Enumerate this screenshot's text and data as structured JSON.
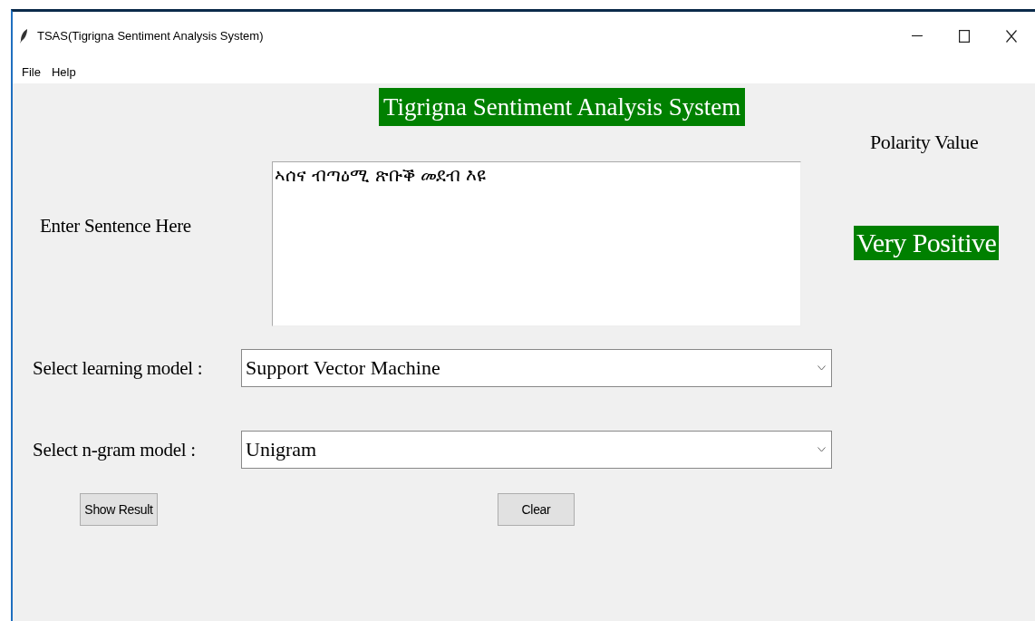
{
  "window": {
    "title": "TSAS(Tigrigna Sentiment Analysis System)"
  },
  "menu": [
    "File",
    "Help"
  ],
  "header": "Tigrigna Sentiment Analysis System",
  "sentence": {
    "label": "Enter Sentence Here",
    "value": "ኣሰና ብጣዕሚ ጽቡቕ መደብ እዩ"
  },
  "polarity": {
    "label": "Polarity Value",
    "value": "Very Positive"
  },
  "selects": [
    {
      "label": "Select learning model :",
      "value": "Support Vector Machine"
    },
    {
      "label": "Select n-gram model :",
      "value": "Unigram"
    }
  ],
  "buttons": [
    "Show Result",
    "Clear"
  ]
}
